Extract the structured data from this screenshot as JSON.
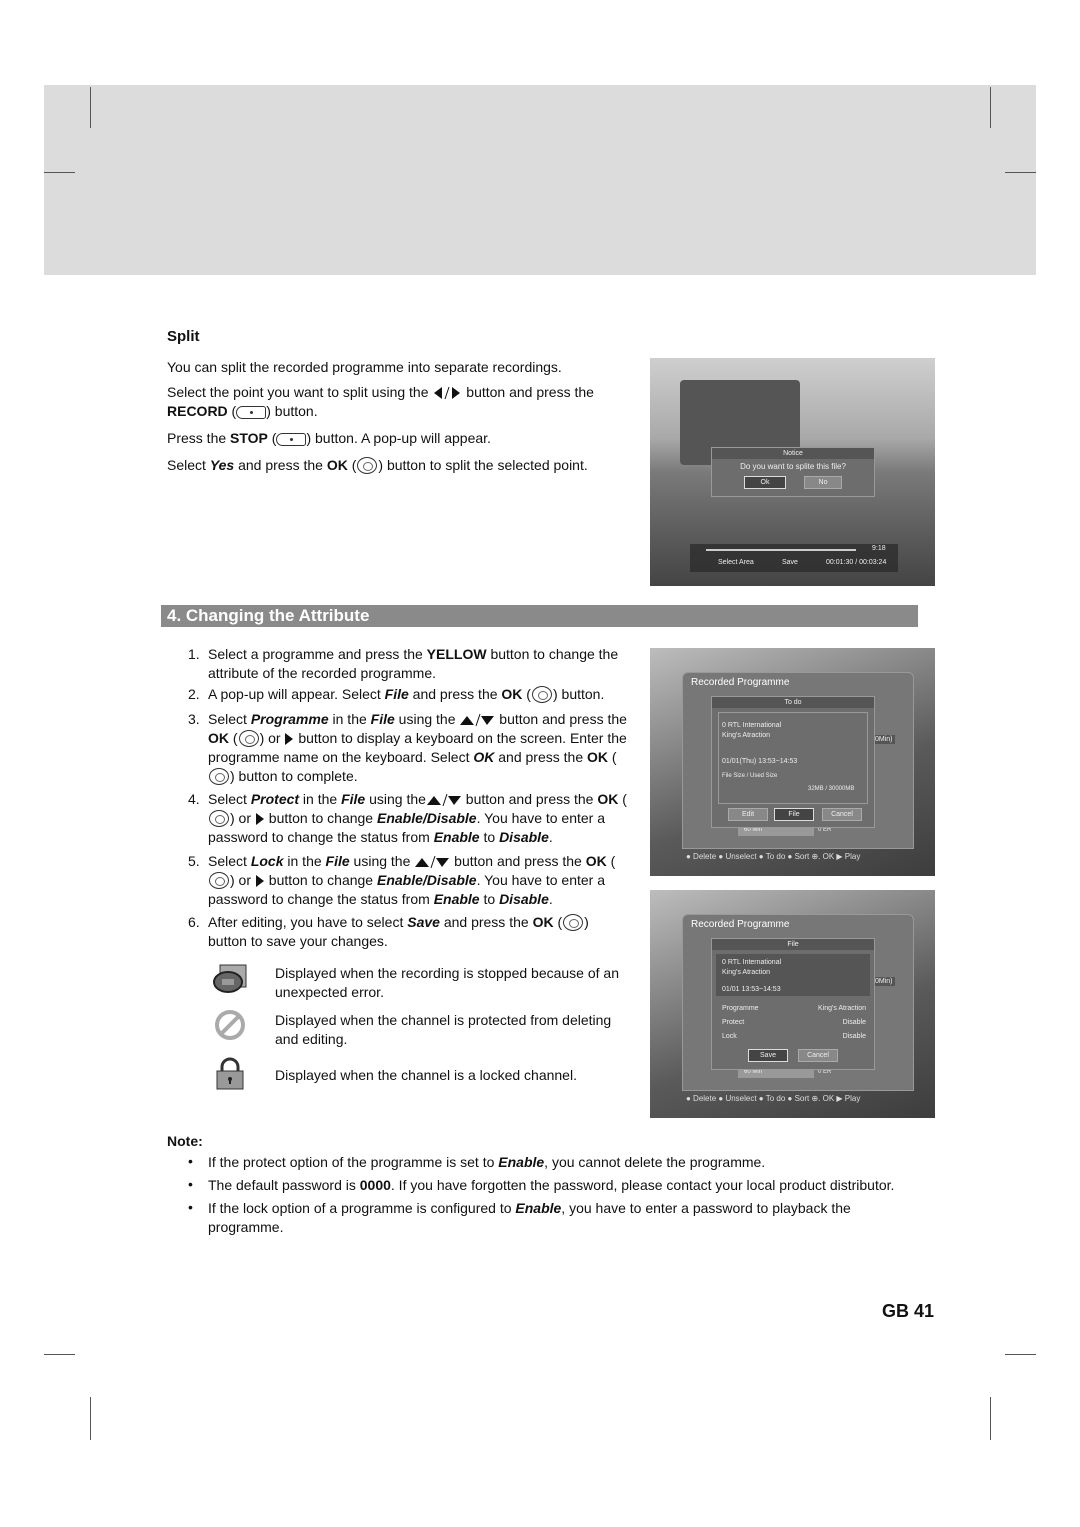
{
  "split": {
    "heading": "Split",
    "paras": [
      [
        {
          "t": "You can split the recorded programme into separate recordings."
        }
      ],
      [
        {
          "t": "Select the point you want to split using the "
        },
        {
          "icon": "left-right-arrows"
        },
        {
          "t": " button and press the "
        },
        {
          "t": "RECORD",
          "s": "b"
        },
        {
          "t": " ("
        },
        {
          "icon": "record-button"
        },
        {
          "t": ") button."
        }
      ],
      [
        {
          "t": "Press the "
        },
        {
          "t": "STOP",
          "s": "b"
        },
        {
          "t": " ("
        },
        {
          "icon": "stop-button"
        },
        {
          "t": ") button. A pop-up will appear."
        }
      ],
      [
        {
          "t": "Select "
        },
        {
          "t": "Yes",
          "s": "bi"
        },
        {
          "t": " and press the "
        },
        {
          "t": "OK",
          "s": "b"
        },
        {
          "t": " ("
        },
        {
          "icon": "ok-button"
        },
        {
          "t": ") button to split the selected point."
        }
      ]
    ],
    "screen": {
      "notice_title": "Notice",
      "notice_text": "Do you want to splite this file?",
      "ok": "Ok",
      "no": "No",
      "time": "9:18",
      "select_area": "Select Area",
      "save": "Save",
      "progress": "00:01:30 / 00:03:24"
    }
  },
  "section": {
    "title": "4. Changing the Attribute"
  },
  "steps": [
    {
      "n": "1.",
      "segs": [
        {
          "t": "Select a programme and press the "
        },
        {
          "t": "YELLOW",
          "s": "b"
        },
        {
          "t": " button to change the attribute of the recorded programme."
        }
      ]
    },
    {
      "n": "2.",
      "segs": [
        {
          "t": "A pop-up will appear. Select "
        },
        {
          "t": "File",
          "s": "bi"
        },
        {
          "t": " and press the "
        },
        {
          "t": "OK",
          "s": "b"
        },
        {
          "t": " ("
        },
        {
          "icon": "ok-button"
        },
        {
          "t": ") button."
        }
      ]
    },
    {
      "n": "3.",
      "segs": [
        {
          "t": "Select "
        },
        {
          "t": "Programme",
          "s": "bi"
        },
        {
          "t": " in the "
        },
        {
          "t": "File",
          "s": "bi"
        },
        {
          "t": " using the "
        },
        {
          "icon": "up-down-arrows"
        },
        {
          "t": " button and press the "
        },
        {
          "t": "OK",
          "s": "b"
        },
        {
          "t": " ("
        },
        {
          "icon": "ok-button"
        },
        {
          "t": ") or "
        },
        {
          "icon": "right-arrow"
        },
        {
          "t": " button to display a keyboard on the screen. Enter the programme name on the keyboard. Select "
        },
        {
          "t": "OK",
          "s": "bi"
        },
        {
          "t": " and press the "
        },
        {
          "t": "OK",
          "s": "b"
        },
        {
          "t": " ("
        },
        {
          "icon": "ok-button"
        },
        {
          "t": ") button to complete."
        }
      ]
    },
    {
      "n": "4.",
      "segs": [
        {
          "t": "Select "
        },
        {
          "t": "Protect",
          "s": "bi"
        },
        {
          "t": " in the "
        },
        {
          "t": "File",
          "s": "bi"
        },
        {
          "t": " using the"
        },
        {
          "icon": "up-down-arrows"
        },
        {
          "t": " button and press the "
        },
        {
          "t": "OK",
          "s": "b"
        },
        {
          "t": " ("
        },
        {
          "icon": "ok-button"
        },
        {
          "t": ") or "
        },
        {
          "icon": "right-arrow"
        },
        {
          "t": " button to change "
        },
        {
          "t": "Enable/Disable",
          "s": "bi"
        },
        {
          "t": ". You have to enter a password to change the status from "
        },
        {
          "t": "Enable",
          "s": "bi"
        },
        {
          "t": " to "
        },
        {
          "t": "Disable",
          "s": "bi"
        },
        {
          "t": "."
        }
      ]
    },
    {
      "n": "5.",
      "segs": [
        {
          "t": "Select "
        },
        {
          "t": "Lock",
          "s": "bi"
        },
        {
          "t": " in the "
        },
        {
          "t": "File",
          "s": "bi"
        },
        {
          "t": " using the "
        },
        {
          "icon": "up-down-arrows"
        },
        {
          "t": " button and press the "
        },
        {
          "t": "OK",
          "s": "b"
        },
        {
          "t": " ("
        },
        {
          "icon": "ok-button"
        },
        {
          "t": ") or "
        },
        {
          "icon": "right-arrow"
        },
        {
          "t": " button to change "
        },
        {
          "t": "Enable/Disable",
          "s": "bi"
        },
        {
          "t": ". You have to enter a password to change the status from "
        },
        {
          "t": "Enable",
          "s": "bi"
        },
        {
          "t": " to "
        },
        {
          "t": "Disable",
          "s": "bi"
        },
        {
          "t": "."
        }
      ]
    },
    {
      "n": "6.",
      "segs": [
        {
          "t": "After editing, you have to select "
        },
        {
          "t": "Save",
          "s": "bi"
        },
        {
          "t": " and press the "
        },
        {
          "t": "OK",
          "s": "b"
        },
        {
          "t": " ("
        },
        {
          "icon": "ok-button"
        },
        {
          "t": ") button to save your changes."
        }
      ]
    }
  ],
  "legend": [
    {
      "icon": "recording-error-icon",
      "text": "Displayed when the recording is stopped because of an unexpected error."
    },
    {
      "icon": "protected-icon",
      "text": "Displayed when the channel is protected from deleting and editing."
    },
    {
      "icon": "lock-icon",
      "text": "Displayed when the channel is a locked channel."
    }
  ],
  "screen2": {
    "title": "Recorded Programme",
    "dialog_title": "To do",
    "channel": "0 RTL International",
    "programme": "King's Atraction",
    "datetime": "01/01(Thu) 13:53~14:53",
    "size_label": "File Size / Used Size",
    "size_value": "32MB / 30000MB",
    "buttons": [
      "Edit",
      "File",
      "Cancel"
    ],
    "side": "0Min)",
    "bar": "60 Min",
    "er": "0 ER",
    "footer": "● Delete  ● Unselect ● To do   ● Sort ⊕.  OK ▶ Play"
  },
  "screen3": {
    "title": "Recorded Programme",
    "dialog_title": "File",
    "channel": "0  RTL International",
    "programme": "King's Atraction",
    "datetime": "01/01  13:53~14:53",
    "rows": [
      {
        "label": "Programme",
        "value": "King's Atraction"
      },
      {
        "label": "Protect",
        "value": "Disable"
      },
      {
        "label": "Lock",
        "value": "Disable"
      }
    ],
    "buttons": [
      "Save",
      "Cancel"
    ],
    "side": "0Min)",
    "bar": "60 Min",
    "er": "0 ER",
    "footer": "● Delete  ● Unselect ● To do   ● Sort ⊕.  OK ▶ Play"
  },
  "note": {
    "label": "Note:",
    "bullet": "•",
    "items": [
      [
        {
          "t": "If the protect option of the programme is set to "
        },
        {
          "t": "Enable",
          "s": "bi"
        },
        {
          "t": ", you cannot delete the programme."
        }
      ],
      [
        {
          "t": "The default password is "
        },
        {
          "t": "0000",
          "s": "b"
        },
        {
          "t": ". If you have forgotten the password, please contact your local product distributor."
        }
      ],
      [
        {
          "t": "If the lock option of a programme is configured to "
        },
        {
          "t": "Enable",
          "s": "bi"
        },
        {
          "t": ", you have to enter a password to playback the programme."
        }
      ]
    ]
  },
  "page_number": "GB 41"
}
